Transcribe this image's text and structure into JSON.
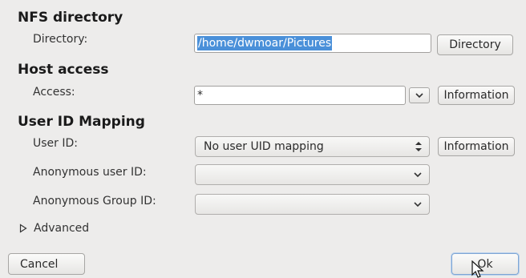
{
  "sections": {
    "nfs_directory": "NFS directory",
    "host_access": "Host access",
    "user_id_mapping": "User ID Mapping"
  },
  "directory": {
    "label": "Directory:",
    "value": "/home/dwmoar/Pictures",
    "button": "Directory"
  },
  "access": {
    "label": "Access:",
    "value": "*",
    "button": "Information"
  },
  "user_id": {
    "label": "User ID:",
    "value": "No user UID mapping",
    "button": "Information"
  },
  "anon_user": {
    "label": "Anonymous user ID:",
    "value": ""
  },
  "anon_group": {
    "label": "Anonymous Group ID:",
    "value": ""
  },
  "advanced": {
    "label": "Advanced"
  },
  "footer": {
    "cancel": "Cancel",
    "ok": "Ok"
  },
  "icons": {
    "expander": "triangle-right-icon",
    "dropdown": "chevron-down-icon",
    "spinner": "updown-arrows-icon",
    "cursor": "mouse-pointer-icon"
  }
}
